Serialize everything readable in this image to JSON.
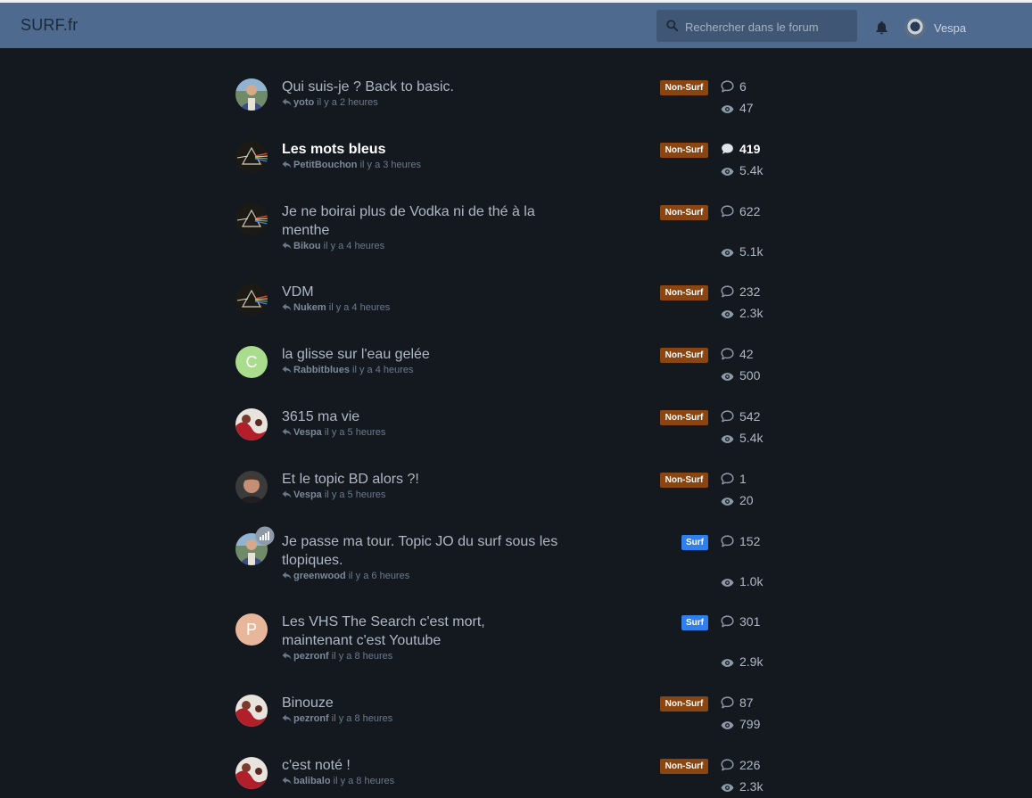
{
  "app": {
    "brand": "SURF.fr",
    "search_placeholder": "Rechercher dans le forum",
    "username": "Vespa"
  },
  "colors": {
    "header_bg": "#4f6a8f",
    "page_bg": "#141920",
    "tag_nonsurf": "#8a4511",
    "tag_surf": "#2f80ed"
  },
  "topics": [
    {
      "title": "Qui suis-je ? Back to basic.",
      "author": "yoto",
      "time": "il y a 2 heures",
      "tag": "Non-Surf",
      "replies": "6",
      "views": "47",
      "unread": false,
      "avatar": "photo-man"
    },
    {
      "title": "Les mots bleus",
      "author": "PetitBouchon",
      "time": "il y a 3 heures",
      "tag": "Non-Surf",
      "replies": "419",
      "views": "5.4k",
      "unread": true,
      "avatar": "prism"
    },
    {
      "title": "Je ne boirai plus de Vodka ni de thé à la menthe",
      "author": "Bikou",
      "time": "il y a 4 heures",
      "tag": "Non-Surf",
      "replies": "622",
      "views": "5.1k",
      "unread": false,
      "avatar": "prism"
    },
    {
      "title": "VDM",
      "author": "Nukem",
      "time": "il y a 4 heures",
      "tag": "Non-Surf",
      "replies": "232",
      "views": "2.3k",
      "unread": false,
      "avatar": "prism"
    },
    {
      "title": "la glisse sur l'eau gelée",
      "author": "Rabbitblues",
      "time": "il y a 4 heures",
      "tag": "Non-Surf",
      "replies": "42",
      "views": "500",
      "unread": false,
      "avatar": "letter",
      "letter": "C",
      "avatar_color": "#a9dc8c"
    },
    {
      "title": "3615 ma vie",
      "author": "Vespa",
      "time": "il y a 5 heures",
      "tag": "Non-Surf",
      "replies": "542",
      "views": "5.4k",
      "unread": false,
      "avatar": "photo-red"
    },
    {
      "title": "Et le topic BD alors ?!",
      "author": "Vespa",
      "time": "il y a 5 heures",
      "tag": "Non-Surf",
      "replies": "1",
      "views": "20",
      "unread": false,
      "avatar": "photo-face"
    },
    {
      "title": "Je passe ma tour. Topic JO du surf sous les tlopiques.",
      "author": "greenwood",
      "time": "il y a 6 heures",
      "tag": "Surf",
      "replies": "152",
      "views": "1.0k",
      "unread": false,
      "avatar": "photo-man",
      "flair": true
    },
    {
      "title": "Les VHS The Search c'est mort, maintenant c'est Youtube",
      "author": "pezronf",
      "time": "il y a 8 heures",
      "tag": "Surf",
      "replies": "301",
      "views": "2.9k",
      "unread": false,
      "avatar": "letter",
      "letter": "P",
      "avatar_color": "#e7b69b"
    },
    {
      "title": "Binouze",
      "author": "pezronf",
      "time": "il y a 8 heures",
      "tag": "Non-Surf",
      "replies": "87",
      "views": "799",
      "unread": false,
      "avatar": "photo-red"
    },
    {
      "title": "c'est noté !",
      "author": "balibalo",
      "time": "il y a 8 heures",
      "tag": "Non-Surf",
      "replies": "226",
      "views": "2.3k",
      "unread": false,
      "avatar": "photo-red"
    }
  ]
}
